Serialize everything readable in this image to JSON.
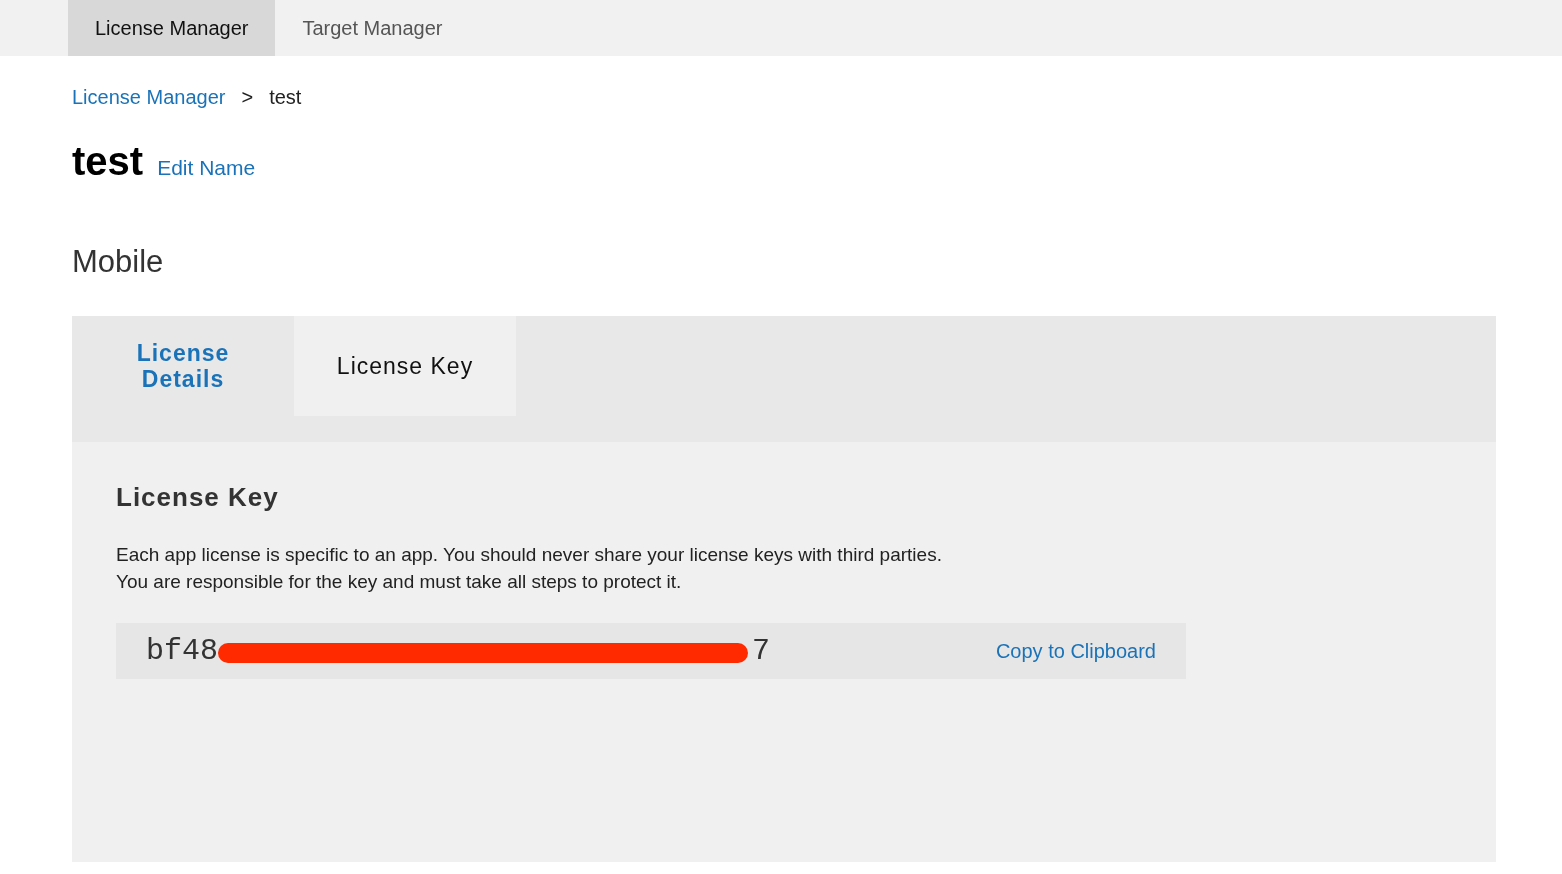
{
  "top_tabs": [
    {
      "label": "License Manager",
      "selected": true
    },
    {
      "label": "Target Manager",
      "selected": false
    }
  ],
  "breadcrumb": {
    "link": "License Manager",
    "separator": ">",
    "current": "test"
  },
  "title": "test",
  "edit_link": "Edit Name",
  "section_title": "Mobile",
  "panel_tabs": [
    {
      "label": "License Details",
      "selected": false
    },
    {
      "label": "License Key",
      "selected": true
    }
  ],
  "panel": {
    "heading": "License Key",
    "description": [
      "Each app license is specific to an app. You should never share your license keys with third parties.",
      "You are responsible for the key and must take all steps to protect it."
    ],
    "key_start": "bf48",
    "key_end": "7",
    "redacted": true,
    "copy_link": "Copy to Clipboard"
  }
}
